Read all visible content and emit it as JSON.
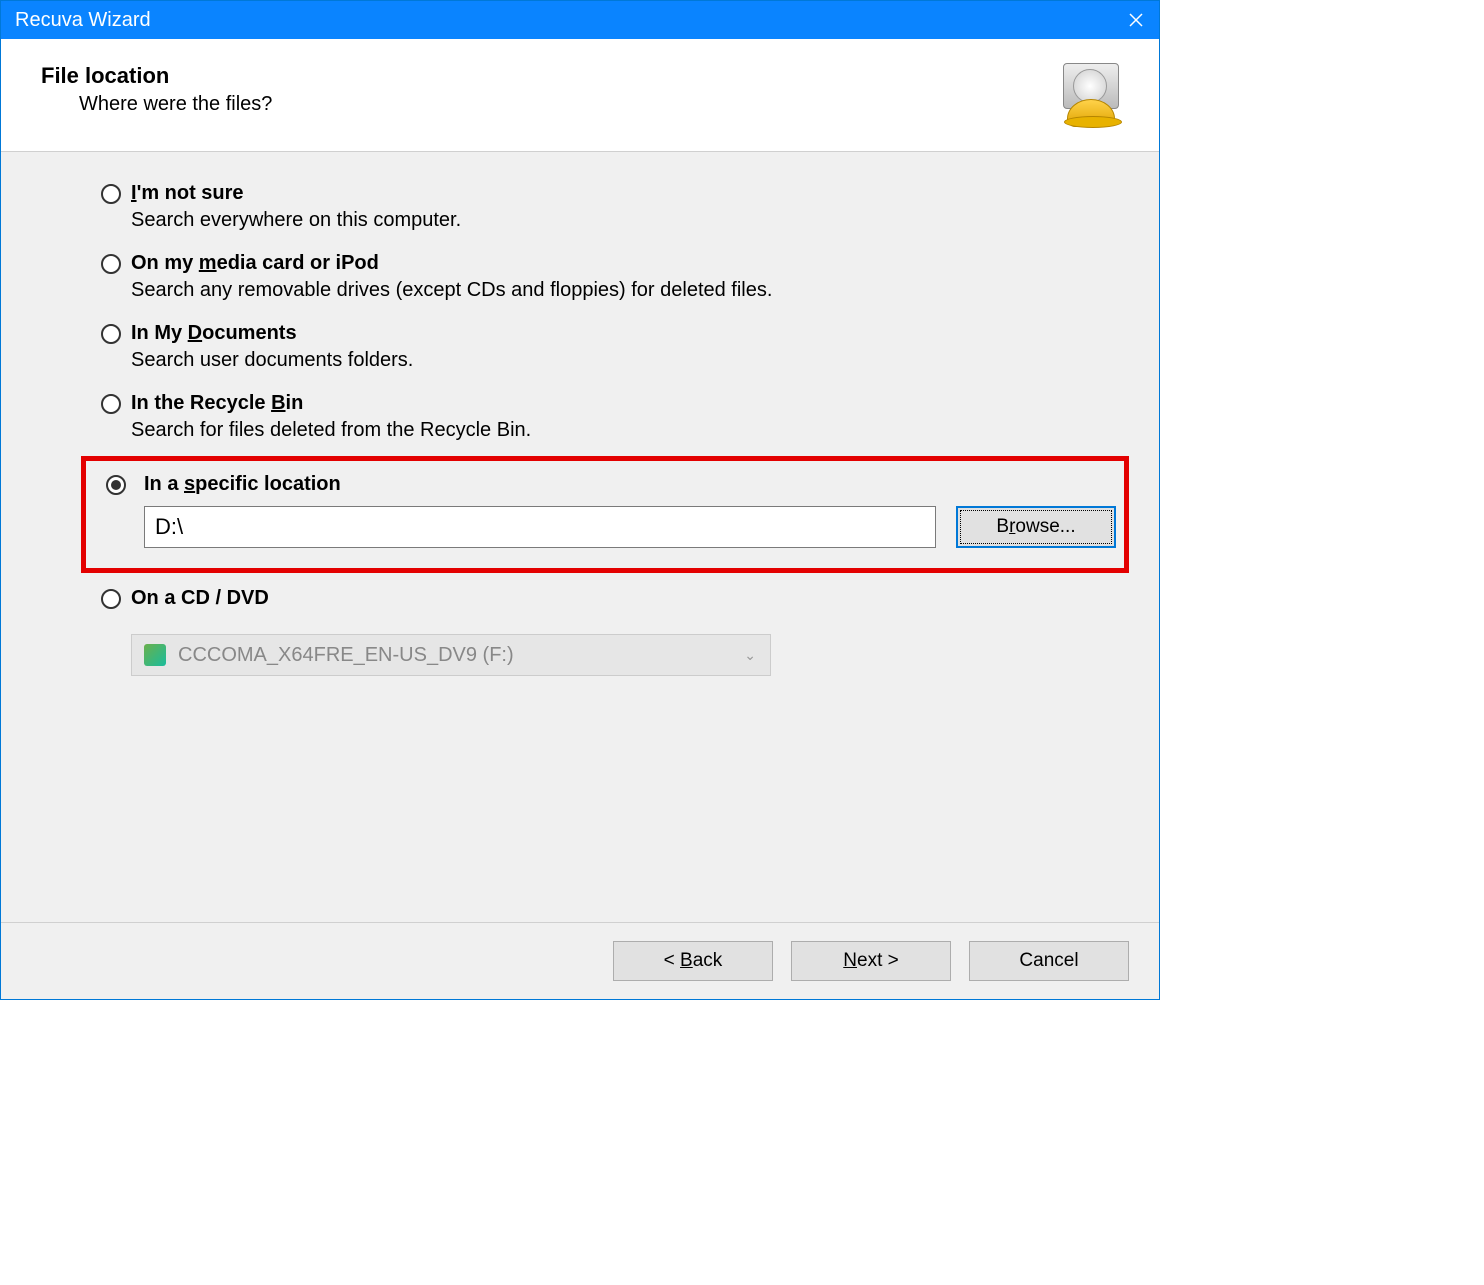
{
  "window": {
    "title": "Recuva Wizard"
  },
  "header": {
    "title": "File location",
    "subtitle": "Where were the files?"
  },
  "options": {
    "not_sure": {
      "label_pre": "",
      "label_u": "I",
      "label_post": "'m not sure",
      "desc": "Search everywhere on this computer."
    },
    "media": {
      "label_pre": "On my ",
      "label_u": "m",
      "label_post": "edia card or iPod",
      "desc": "Search any removable drives (except CDs and floppies) for deleted files."
    },
    "documents": {
      "label_pre": "In My ",
      "label_u": "D",
      "label_post": "ocuments",
      "desc": "Search user documents folders."
    },
    "recycle": {
      "label_pre": "In the Recycle ",
      "label_u": "B",
      "label_post": "in",
      "desc": "Search for files deleted from the Recycle Bin."
    },
    "specific": {
      "label_pre": "In a ",
      "label_u": "s",
      "label_post": "pecific location",
      "path": "D:\\",
      "browse_pre": "B",
      "browse_u": "r",
      "browse_post": "owse..."
    },
    "cd": {
      "label_pre": "On a CD / DVD",
      "combo": "CCCOMA_X64FRE_EN-US_DV9 (F:)"
    }
  },
  "footer": {
    "back_pre": "< ",
    "back_u": "B",
    "back_post": "ack",
    "next_u": "N",
    "next_post": "ext >",
    "cancel": "Cancel"
  }
}
